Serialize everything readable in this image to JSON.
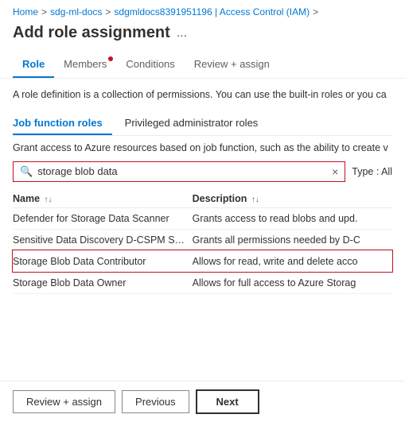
{
  "breadcrumb": {
    "items": [
      {
        "label": "Home",
        "link": true
      },
      {
        "label": "sdg-ml-docs",
        "link": true
      },
      {
        "label": "sdgmldocs8391951196 | Access Control (IAM)",
        "link": true
      }
    ],
    "separator": ">"
  },
  "page": {
    "title": "Add role assignment",
    "ellipsis": "..."
  },
  "tabs": [
    {
      "id": "role",
      "label": "Role",
      "active": true,
      "dot": false
    },
    {
      "id": "members",
      "label": "Members",
      "active": false,
      "dot": true
    },
    {
      "id": "conditions",
      "label": "Conditions",
      "active": false,
      "dot": false
    },
    {
      "id": "review-assign",
      "label": "Review + assign",
      "active": false,
      "dot": false
    }
  ],
  "description": "A role definition is a collection of permissions. You can use the built-in roles or you ca",
  "sub_tabs": [
    {
      "id": "job-function",
      "label": "Job function roles",
      "active": true
    },
    {
      "id": "privileged-admin",
      "label": "Privileged administrator roles",
      "active": false
    }
  ],
  "sub_description": "Grant access to Azure resources based on job function, such as the ability to create v",
  "search": {
    "value": "storage blob data",
    "placeholder": "Search",
    "clear_label": "×"
  },
  "type_filter": {
    "label": "Type : All"
  },
  "table": {
    "columns": [
      {
        "id": "name",
        "label": "Name",
        "sort": "↑↓"
      },
      {
        "id": "description",
        "label": "Description",
        "sort": "↑↓"
      }
    ],
    "rows": [
      {
        "id": "row1",
        "name": "Defender for Storage Data Scanner",
        "description": "Grants access to read blobs and upd.",
        "highlighted": false
      },
      {
        "id": "row2",
        "name": "Sensitive Data Discovery D-CSPM Scanner O...",
        "description": "Grants all permissions needed by D-C",
        "highlighted": false
      },
      {
        "id": "row3",
        "name": "Storage Blob Data Contributor",
        "description": "Allows for read, write and delete acco",
        "highlighted": true
      },
      {
        "id": "row4",
        "name": "Storage Blob Data Owner",
        "description": "Allows for full access to Azure Storag",
        "highlighted": false
      }
    ]
  },
  "footer": {
    "review_assign_label": "Review + assign",
    "previous_label": "Previous",
    "next_label": "Next"
  }
}
